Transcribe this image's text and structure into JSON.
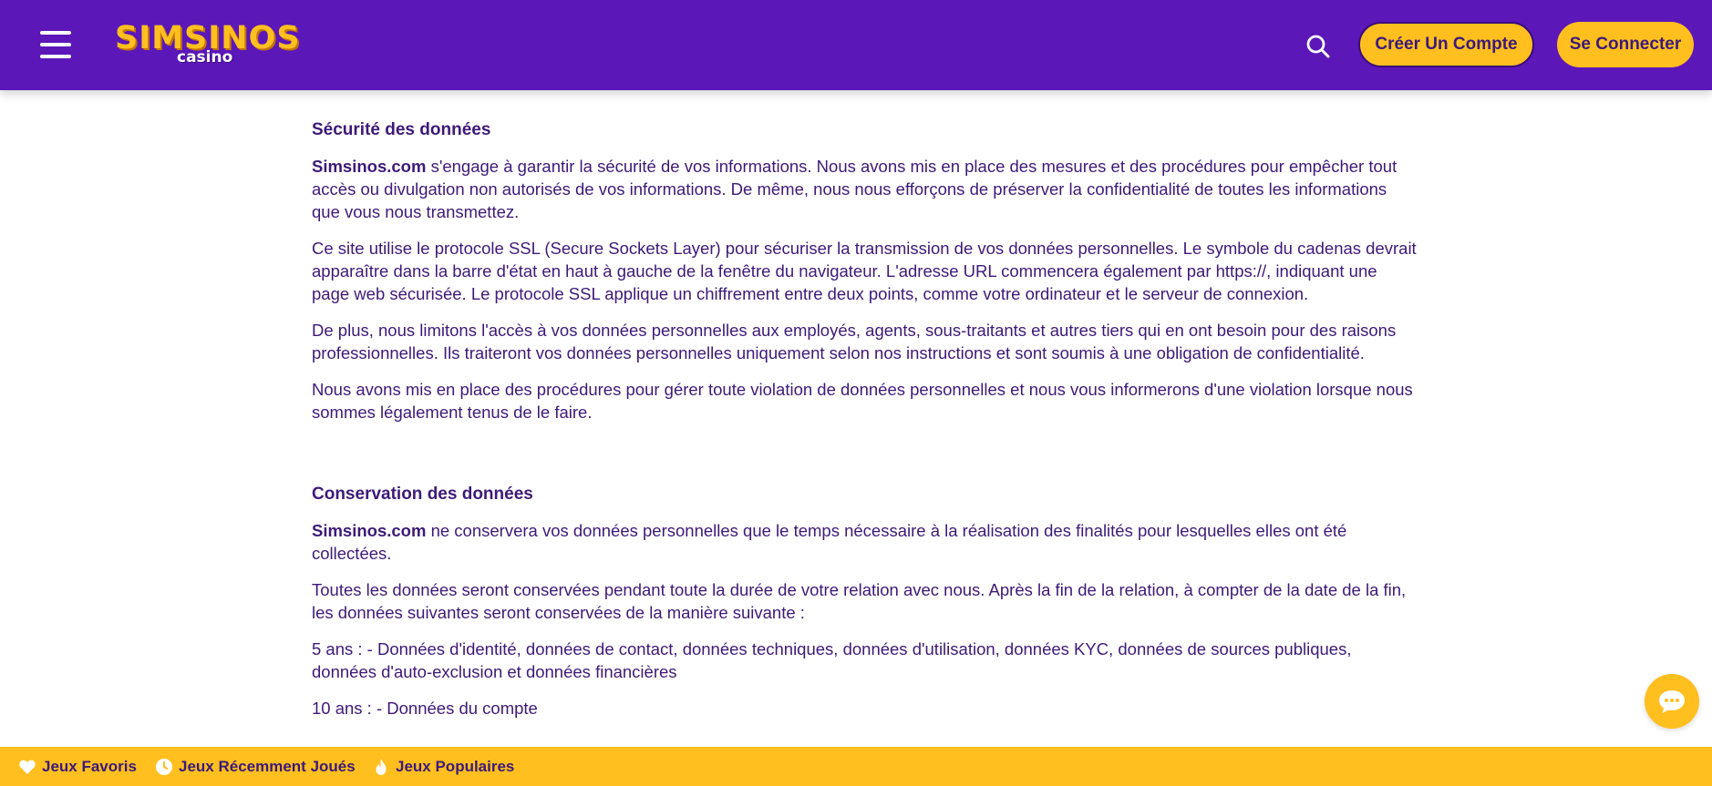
{
  "header": {
    "logo_text": "SIMSINOS",
    "logo_sub": "casino",
    "create_account": "Créer Un Compte",
    "login": "Se Connecter",
    "colors": {
      "background": "#5b17b8",
      "accent": "#ffbf1f"
    }
  },
  "icons": {
    "menu": "hamburger-menu-icon",
    "search": "search-icon",
    "chat": "chat-icon",
    "heart": "heart-icon",
    "clock": "clock-icon",
    "flame": "flame-icon"
  },
  "content": {
    "security_title": "Sécurité des données",
    "p1_brand": "Simsinos.com",
    "p1_text": " s'engage à garantir la sécurité de vos informations. Nous avons mis en place des mesures et des procédures pour empêcher tout accès ou divulgation non autorisés de vos informations. De même, nous nous efforçons de préserver la confidentialité de toutes les informations que vous nous transmettez.",
    "p2": "Ce site utilise le protocole SSL (Secure Sockets Layer) pour sécuriser la transmission de vos données personnelles. Le symbole du cadenas devrait apparaître dans la barre d'état en haut à gauche de la fenêtre du navigateur. L'adresse URL commencera également par https://, indiquant une page web sécurisée. Le protocole SSL applique un chiffrement entre deux points, comme votre ordinateur et le serveur de connexion.",
    "p3": "De plus, nous limitons l'accès à vos données personnelles aux employés, agents, sous-traitants et autres tiers qui en ont besoin pour des raisons professionnelles. Ils traiteront vos données personnelles uniquement selon nos instructions et sont soumis à une obligation de confidentialité.",
    "p4": "Nous avons mis en place des procédures pour gérer toute violation de données personnelles et nous vous informerons d'une violation lorsque nous sommes légalement tenus de le faire.",
    "retention_title": "Conservation des données",
    "p5_brand": "Simsinos.com",
    "p5_text": " ne conservera vos données personnelles que le temps nécessaire à la réalisation des finalités pour lesquelles elles ont été collectées.",
    "p6": "Toutes les données seront conservées pendant toute la durée de votre relation avec nous. Après la fin de la relation, à compter de la date de la fin, les données suivantes seront conservées de la manière suivante :",
    "p7": "5 ans : - Données d'identité, données de contact, données techniques, données d'utilisation, données KYC, données de sources publiques, données d'auto-exclusion et données financières",
    "p8": "10 ans : - Données du compte"
  },
  "footer": {
    "favorites": "Jeux Favoris",
    "recent": "Jeux Récemment Joués",
    "popular": "Jeux Populaires"
  }
}
